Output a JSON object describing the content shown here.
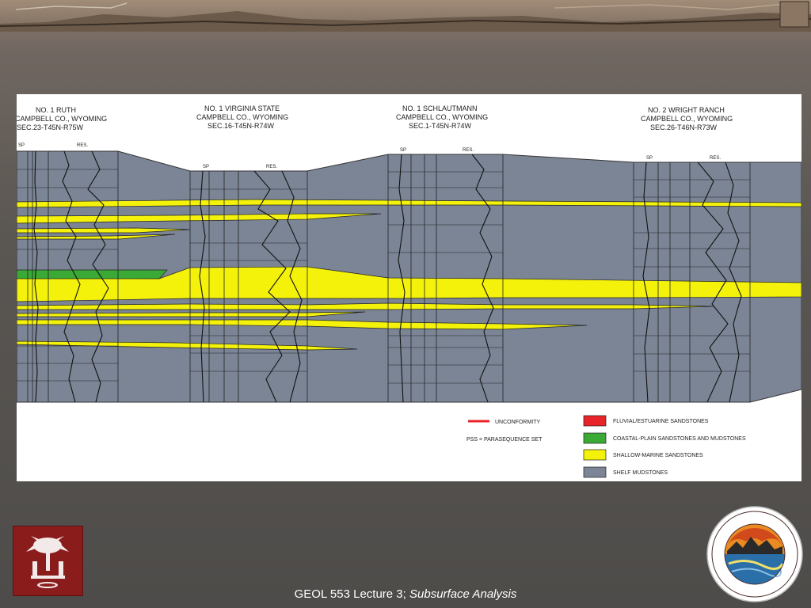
{
  "wells": [
    {
      "name": "NO. 1 RUTH",
      "county": "CAMPBELL CO., WYOMING",
      "location": "SEC.23-T45N-R75W",
      "sp": "SP",
      "res": "RES."
    },
    {
      "name": "NO. 1 VIRGINIA STATE",
      "county": "CAMPBELL CO., WYOMING",
      "location": "SEC.16-T45N-R74W",
      "sp": "SP",
      "res": "RES."
    },
    {
      "name": "NO. 1 SCHLAUTMANN",
      "county": "CAMPBELL CO., WYOMING",
      "location": "SEC.1-T45N-R74W",
      "sp": "SP",
      "res": "RES."
    },
    {
      "name": "NO. 2 WRIGHT RANCH",
      "county": "CAMPBELL CO., WYOMING",
      "location": "SEC.26-T46N-R73W",
      "sp": "SP",
      "res": "RES."
    }
  ],
  "legend": {
    "unconformity": "UNCONFORMITY",
    "pss": "PSS  =  PARASEQUENCE SET",
    "items": [
      {
        "label": "FLUVIAL/ESTUARINE SANDSTONES",
        "color": "#e8242a"
      },
      {
        "label": "COASTAL-PLAIN SANDSTONES AND MUDSTONES",
        "color": "#3aa935"
      },
      {
        "label": "SHALLOW-MARINE SANDSTONES",
        "color": "#f4f20a"
      },
      {
        "label": "SHELF MUDSTONES",
        "color": "#7b8596"
      }
    ]
  },
  "footer": {
    "course": "GEOL 553 Lecture 3; ",
    "topic": "Subsurface Analysis"
  },
  "colors": {
    "mudstone": "#7b8596",
    "sandstone": "#f4f20a",
    "coastal": "#3aa935",
    "unconformity": "#e8242a"
  },
  "icons": {
    "usc_logo": "palmetto-tree-logo",
    "dept_seal": "department-of-geological-sciences-seal"
  }
}
